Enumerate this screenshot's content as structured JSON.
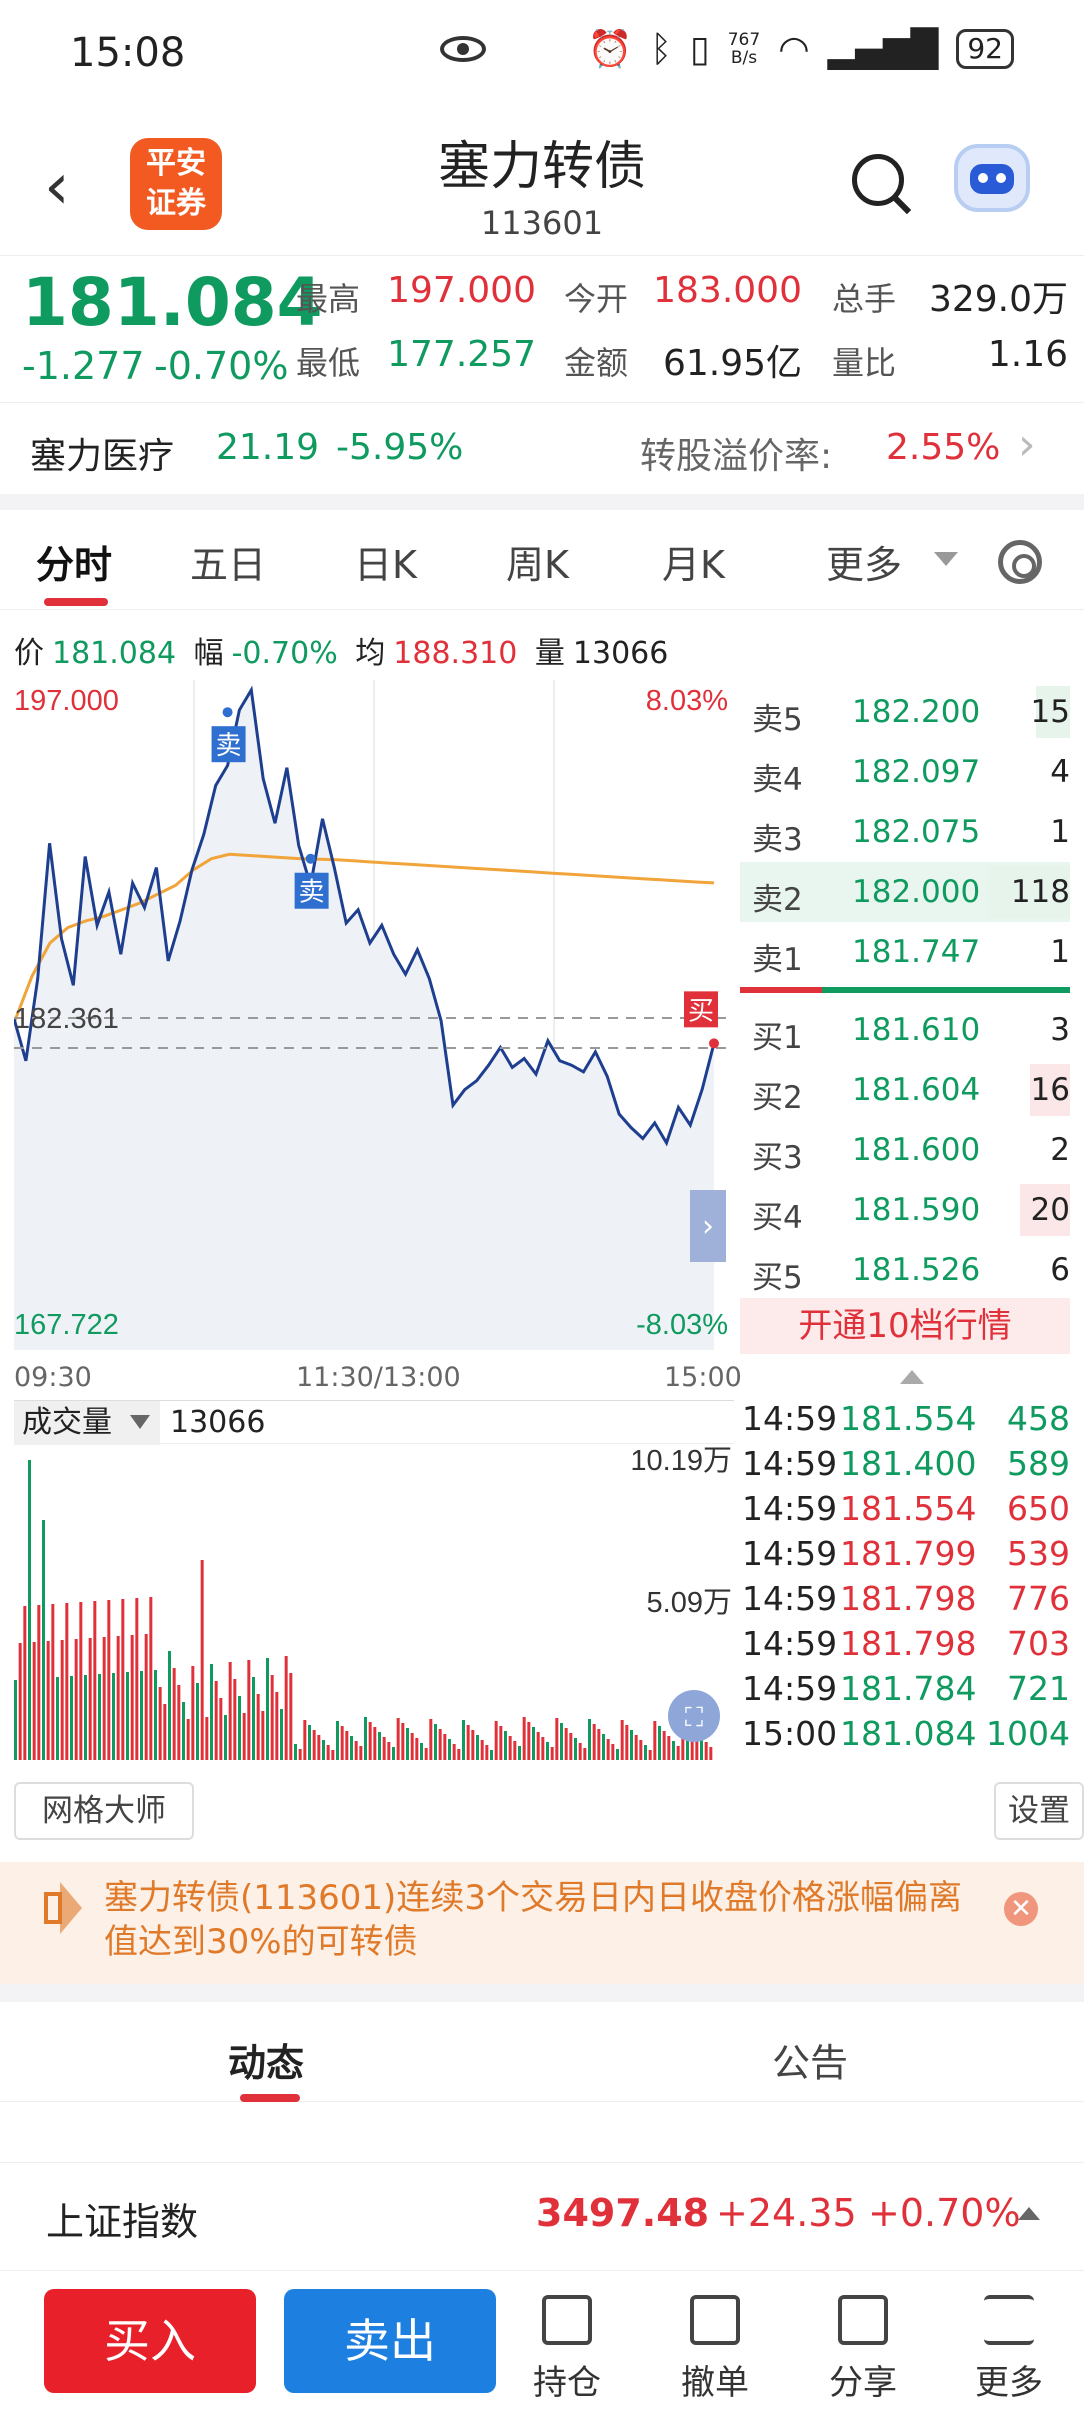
{
  "status_bar": {
    "time": "15:08",
    "net_speed_top": "767",
    "net_speed_unit": "B/s",
    "battery": "92"
  },
  "header": {
    "logo_line1": "平安",
    "logo_line2": "证券",
    "title": "塞力转债",
    "code": "113601"
  },
  "quote": {
    "price": "181.084",
    "change": "-1.277",
    "change_pct": "-0.70%",
    "high_label": "最高",
    "high": "197.000",
    "open_label": "今开",
    "open": "183.000",
    "volume_label": "总手",
    "volume": "329.0万",
    "low_label": "最低",
    "low": "177.257",
    "amount_label": "金额",
    "amount": "61.95亿",
    "ratio_label": "量比",
    "ratio": "1.16"
  },
  "underlying": {
    "name": "塞力医疗",
    "price": "21.19",
    "change_pct": "-5.95%",
    "premium_label": "转股溢价率:",
    "premium": "2.55%"
  },
  "tabs": [
    "分时",
    "五日",
    "日K",
    "周K",
    "月K",
    "更多"
  ],
  "info_line": {
    "price_label": "价",
    "price": "181.084",
    "pct_label": "幅",
    "pct": "-0.70%",
    "avg_label": "均",
    "avg": "188.310",
    "vol_label": "量",
    "vol": "13066"
  },
  "chart_data": {
    "type": "line",
    "title": "",
    "x_ticks": [
      "09:30",
      "11:30/13:00",
      "15:00"
    ],
    "ylim": [
      167.722,
      197.0
    ],
    "y_top_label": "197.000",
    "y_bottom_label": "167.722",
    "pct_top": "8.03%",
    "pct_bottom": "-8.03%",
    "ref_label": "182.361",
    "price_series": [
      182.2,
      180.3,
      184.0,
      190.1,
      185.8,
      183.7,
      189.5,
      186.4,
      187.9,
      185.1,
      188.3,
      187.2,
      189.0,
      184.8,
      186.6,
      188.9,
      190.5,
      192.7,
      193.6,
      196.1,
      197.0,
      193.0,
      191.0,
      193.5,
      190.0,
      188.2,
      191.2,
      189.0,
      186.5,
      187.1,
      185.6,
      186.4,
      185.1,
      184.2,
      185.3,
      184.0,
      182.1,
      178.3,
      179.0,
      179.4,
      180.1,
      180.9,
      180.0,
      180.4,
      179.7,
      181.2,
      180.3,
      180.1,
      179.8,
      180.7,
      179.6,
      177.9,
      177.3,
      176.8,
      177.5,
      176.6,
      178.2,
      177.4,
      179.0,
      181.084
    ],
    "avg_series": [
      182.0,
      184.1,
      185.6,
      186.3,
      186.6,
      186.8,
      187.1,
      187.4,
      187.8,
      188.2,
      188.9,
      189.4,
      189.6,
      189.55,
      189.5,
      189.45,
      189.4,
      189.38,
      189.35,
      189.3,
      189.25,
      189.2,
      189.15,
      189.1,
      189.05,
      189.0,
      188.95,
      188.9,
      188.85,
      188.8,
      188.75,
      188.7,
      188.65,
      188.6,
      188.55,
      188.5,
      188.45,
      188.4,
      188.35,
      188.31
    ],
    "markers": [
      {
        "label": "卖",
        "value": 196.0
      },
      {
        "label": "卖",
        "value": 189.4
      },
      {
        "label": "买",
        "value": 181.084
      }
    ],
    "volume": {
      "label": "成交量",
      "value": "13066",
      "max_label": "10.19万",
      "mid_label": "5.09万"
    }
  },
  "order_book": {
    "asks": [
      {
        "label": "卖5",
        "price": "182.200",
        "qty": "15"
      },
      {
        "label": "卖4",
        "price": "182.097",
        "qty": "4"
      },
      {
        "label": "卖3",
        "price": "182.075",
        "qty": "1"
      },
      {
        "label": "卖2",
        "price": "182.000",
        "qty": "118"
      },
      {
        "label": "卖1",
        "price": "181.747",
        "qty": "1"
      }
    ],
    "bids": [
      {
        "label": "买1",
        "price": "181.610",
        "qty": "3"
      },
      {
        "label": "买2",
        "price": "181.604",
        "qty": "16"
      },
      {
        "label": "买3",
        "price": "181.600",
        "qty": "2"
      },
      {
        "label": "买4",
        "price": "181.590",
        "qty": "20"
      },
      {
        "label": "买5",
        "price": "181.526",
        "qty": "6"
      }
    ],
    "open10": "开通10档行情"
  },
  "ticks": [
    {
      "time": "14:59",
      "price": "181.554",
      "qty": "458",
      "dir": "green"
    },
    {
      "time": "14:59",
      "price": "181.400",
      "qty": "589",
      "dir": "green"
    },
    {
      "time": "14:59",
      "price": "181.554",
      "qty": "650",
      "dir": "red"
    },
    {
      "time": "14:59",
      "price": "181.799",
      "qty": "539",
      "dir": "red"
    },
    {
      "time": "14:59",
      "price": "181.798",
      "qty": "776",
      "dir": "red"
    },
    {
      "time": "14:59",
      "price": "181.798",
      "qty": "703",
      "dir": "red"
    },
    {
      "time": "14:59",
      "price": "181.784",
      "qty": "721",
      "dir": "green"
    },
    {
      "time": "15:00",
      "price": "181.084",
      "qty": "1004",
      "dir": "green"
    }
  ],
  "tools": {
    "grid_master": "网格大师",
    "settings": "设置"
  },
  "notice": {
    "text": "塞力转债(113601)连续3个交易日内日收盘价格涨幅偏离值达到30%的可转债"
  },
  "news_tabs": [
    "动态",
    "公告"
  ],
  "index_bar": {
    "name": "上证指数",
    "value": "3497.48",
    "change": "+24.35",
    "pct": "+0.70%"
  },
  "bottom_bar": {
    "buy": "买入",
    "sell": "卖出",
    "items": [
      "持仓",
      "撤单",
      "分享",
      "更多"
    ]
  },
  "colors": {
    "red": "#e0313b",
    "green": "#0f9a5f",
    "line": "#1e3f8f",
    "avg": "#f0a43a",
    "buy_btn": "#e8202a",
    "sell_btn": "#1d7fe0"
  }
}
